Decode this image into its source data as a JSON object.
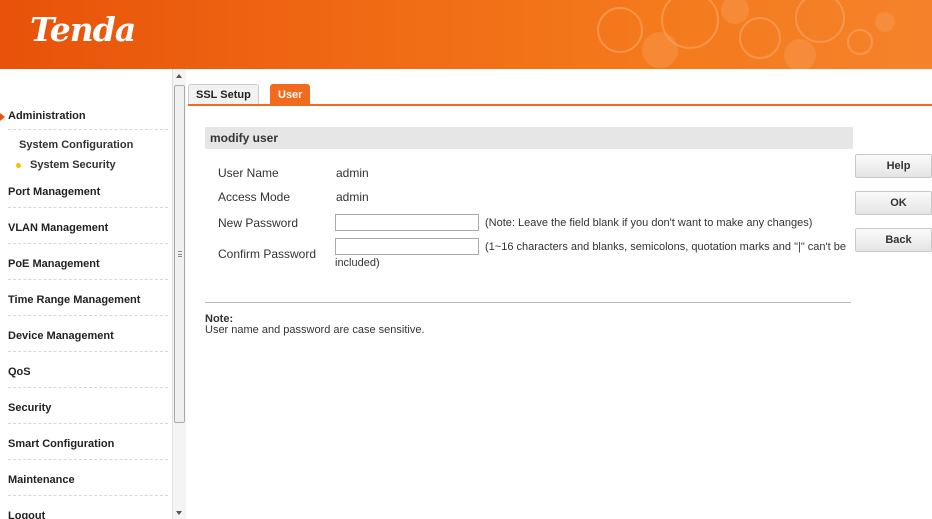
{
  "header": {
    "brand": "Tenda",
    "brand_color": "#e8520a"
  },
  "sidebar": {
    "items": [
      {
        "label": "Administration",
        "active": true
      },
      {
        "label": "Port Management"
      },
      {
        "label": "VLAN Management"
      },
      {
        "label": "PoE Management"
      },
      {
        "label": "Time Range Management"
      },
      {
        "label": "Device Management"
      },
      {
        "label": "QoS"
      },
      {
        "label": "Security"
      },
      {
        "label": "Smart Configuration"
      },
      {
        "label": "Maintenance"
      },
      {
        "label": "Logout"
      }
    ],
    "subitems": [
      {
        "label": "System Configuration"
      },
      {
        "label": "System Security",
        "active": true
      }
    ]
  },
  "tabs": [
    {
      "label": "SSL Setup"
    },
    {
      "label": "User",
      "active": true
    }
  ],
  "main": {
    "section_title": "modify user",
    "fields": {
      "user_name_label": "User Name",
      "user_name_value": "admin",
      "access_mode_label": "Access Mode",
      "access_mode_value": "admin",
      "new_password_label": "New Password",
      "new_password_value": "",
      "new_password_note": "(Note: Leave the field blank if you don't want to make any changes)",
      "confirm_password_label": "Confirm Password",
      "confirm_password_value": "",
      "confirm_password_note_line1": "(1~16 characters and blanks, semicolons, quotation marks and \"|\" can't be",
      "confirm_password_note_line2": "included)"
    },
    "note_title": "Note:",
    "note_body": "User name and password are case sensitive."
  },
  "buttons": {
    "help": "Help",
    "ok": "OK",
    "back": "Back"
  }
}
